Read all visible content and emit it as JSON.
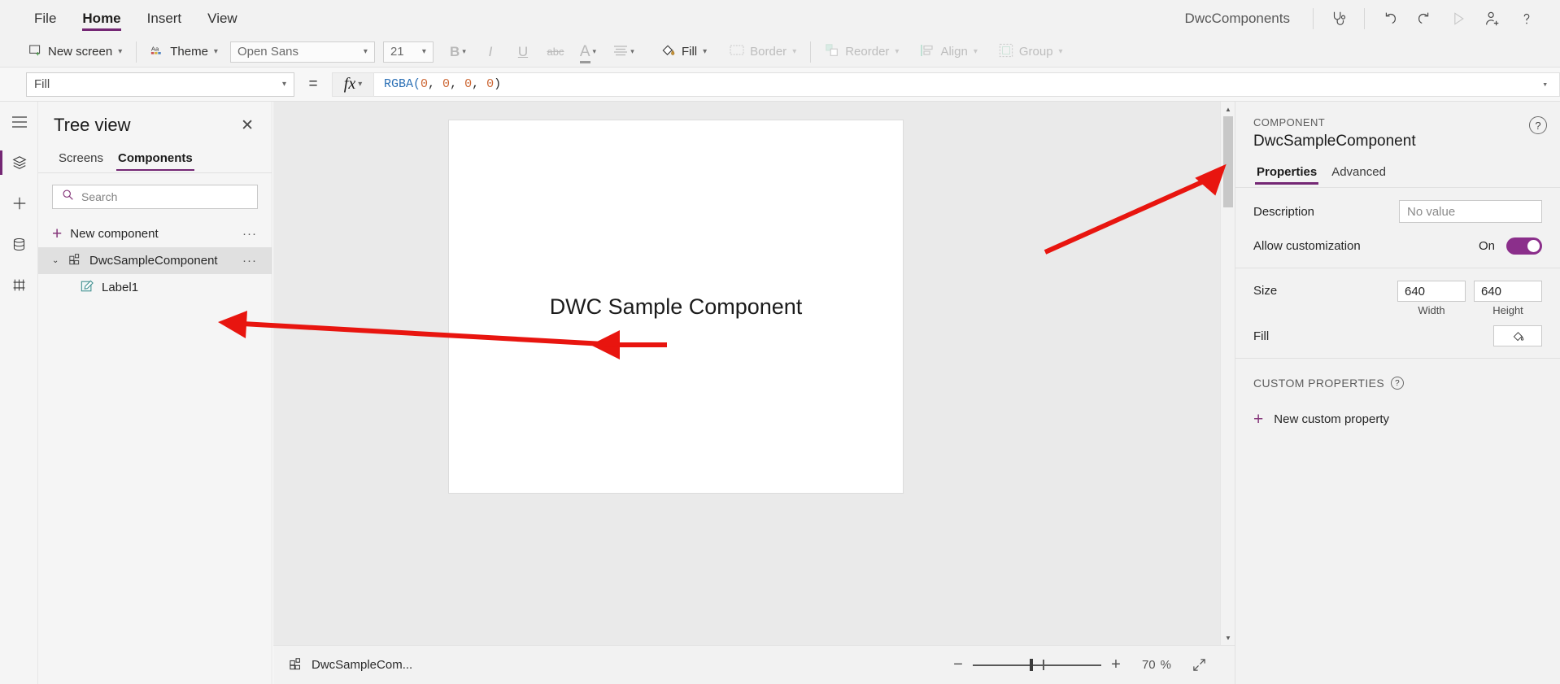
{
  "menubar": {
    "items": [
      {
        "label": "File",
        "active": false
      },
      {
        "label": "Home",
        "active": true
      },
      {
        "label": "Insert",
        "active": false
      },
      {
        "label": "View",
        "active": false
      }
    ],
    "app_title": "DwcComponents",
    "icons": [
      {
        "name": "app-checker-icon",
        "glyph": "stethoscope"
      },
      {
        "name": "undo-icon",
        "glyph": "undo"
      },
      {
        "name": "redo-icon",
        "glyph": "redo"
      },
      {
        "name": "preview-play-icon",
        "glyph": "play"
      },
      {
        "name": "share-add-user-icon",
        "glyph": "person-add"
      },
      {
        "name": "help-icon",
        "glyph": "question"
      }
    ]
  },
  "ribbon": {
    "new_screen": "New screen",
    "theme": "Theme",
    "font_family": "Open Sans",
    "font_size": "21",
    "bold": "B",
    "italic": "I",
    "underline": "U",
    "strikethrough": "abc",
    "font_color": "A",
    "align": "align",
    "fill": "Fill",
    "border": "Border",
    "reorder": "Reorder",
    "align_group": "Align",
    "group": "Group"
  },
  "formulabar": {
    "property": "Fill",
    "equals": "=",
    "fx": "fx",
    "formula_tokens": [
      {
        "text": "RGBA(",
        "type": "fn"
      },
      {
        "text": "0",
        "type": "num"
      },
      {
        "text": ", ",
        "type": "punct"
      },
      {
        "text": "0",
        "type": "num"
      },
      {
        "text": ", ",
        "type": "punct"
      },
      {
        "text": "0",
        "type": "num"
      },
      {
        "text": ", ",
        "type": "punct"
      },
      {
        "text": "0",
        "type": "num"
      },
      {
        "text": ")",
        "type": "punct"
      }
    ],
    "formula_plain": "RGBA(0, 0, 0, 0)"
  },
  "treeview": {
    "title": "Tree view",
    "close": "✕",
    "tabs": [
      {
        "label": "Screens",
        "active": false
      },
      {
        "label": "Components",
        "active": true
      }
    ],
    "search_placeholder": "Search",
    "new_component": "New component",
    "new_component_more": "···",
    "items": [
      {
        "label": "DwcSampleComponent",
        "level": 0,
        "selected": true,
        "more": "···",
        "expander": "⌄"
      },
      {
        "label": "Label1",
        "level": 1,
        "selected": false,
        "more": "",
        "expander": ""
      }
    ]
  },
  "canvas": {
    "label_text": "DWC Sample Component"
  },
  "statusbar": {
    "component_name": "DwcSampleCom...",
    "zoom_out": "−",
    "zoom_in": "+",
    "zoom_value": "70",
    "zoom_unit": "%",
    "fit_screen": "fit-to-screen"
  },
  "properties": {
    "kicker": "COMPONENT",
    "name": "DwcSampleComponent",
    "help": "?",
    "tabs": [
      {
        "label": "Properties",
        "active": true
      },
      {
        "label": "Advanced",
        "active": false
      }
    ],
    "description_label": "Description",
    "description_placeholder": "No value",
    "allow_customization_label": "Allow customization",
    "allow_customization_state": "On",
    "size_label": "Size",
    "width_value": "640",
    "height_value": "640",
    "width_caption": "Width",
    "height_caption": "Height",
    "fill_label": "Fill",
    "custom_properties_title": "CUSTOM PROPERTIES",
    "custom_properties_help": "?",
    "new_custom_property": "New custom property"
  },
  "colors": {
    "accent": "#742774",
    "toggle_on": "#8b2f8b",
    "annotation_arrow": "#e8150f",
    "formula_fn": "#2a6fb5",
    "formula_num": "#cc6633"
  }
}
